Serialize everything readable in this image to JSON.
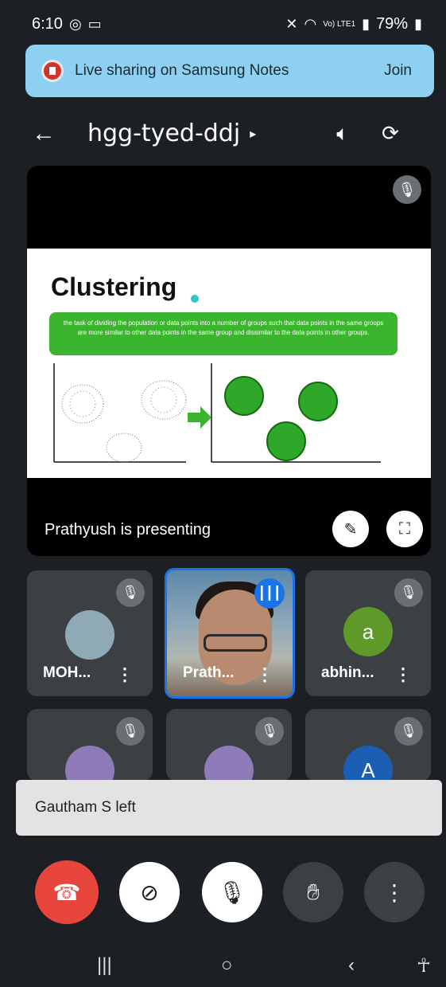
{
  "status": {
    "time": "6:10",
    "network": "Vo) LTE1",
    "battery": "79%"
  },
  "banner": {
    "text": "Live sharing on Samsung Notes",
    "action": "Join"
  },
  "header": {
    "meeting_code": "hgg-tyed-ddj"
  },
  "slide": {
    "title": "Clustering",
    "description": "the task of dividing the population or data points into a number of groups such that data points in the same groups are more similar to other data points in the same group and dissimilar to the data points in other groups."
  },
  "presentation": {
    "label": "Prathyush is presenting"
  },
  "participants": [
    {
      "name": "MOH...",
      "muted": true
    },
    {
      "name": "Prath...",
      "speaking": true
    },
    {
      "name": "abhin...",
      "initial": "a",
      "color": "#5e9a2a",
      "muted": true
    },
    {
      "name": "",
      "muted": true
    },
    {
      "name": "",
      "muted": true
    },
    {
      "name": "",
      "initial": "A",
      "color": "#1a5fb4",
      "muted": true
    }
  ],
  "toast": {
    "text": "Gautham S left"
  },
  "colors": {
    "end_call": "#e8453c",
    "banner": "#8dd0f2",
    "tile": "#3c4043",
    "accent": "#1a73e8"
  }
}
